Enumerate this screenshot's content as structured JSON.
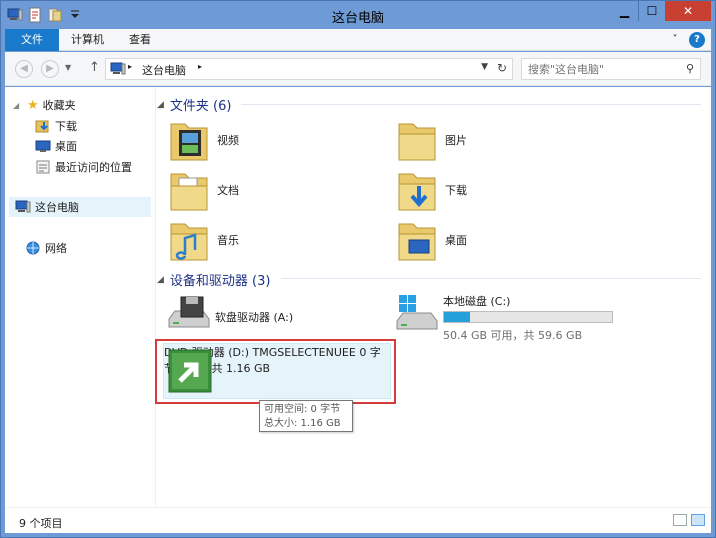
{
  "window": {
    "title": "这台电脑",
    "controls": {
      "minimize": "▁",
      "maximize": "☐",
      "close": "✕"
    }
  },
  "quick_access_icons": [
    "computer-icon",
    "properties-icon",
    "new-folder-icon",
    "customize-dropdown-icon"
  ],
  "ribbon": {
    "tabs": [
      "文件",
      "计算机",
      "查看"
    ],
    "expand_glyph": "˅",
    "help_glyph": "?"
  },
  "address_bar": {
    "breadcrumb": [
      "这台电脑"
    ],
    "separator": "▸",
    "search_placeholder": "搜索\"这台电脑\""
  },
  "navigation": {
    "favorites_label": "收藏夹",
    "favorites": [
      "下载",
      "桌面",
      "最近访问的位置"
    ],
    "this_pc": "这台电脑",
    "network": "网络"
  },
  "folders_section": {
    "heading": "文件夹 (6)",
    "items": [
      {
        "label": "视频",
        "icon": "videos-folder-icon"
      },
      {
        "label": "图片",
        "icon": "pictures-folder-icon"
      },
      {
        "label": "文档",
        "icon": "documents-folder-icon"
      },
      {
        "label": "下载",
        "icon": "downloads-folder-icon"
      },
      {
        "label": "音乐",
        "icon": "music-folder-icon"
      },
      {
        "label": "桌面",
        "icon": "desktop-folder-icon"
      }
    ]
  },
  "devices_section": {
    "heading": "设备和驱动器 (3)",
    "floppy": {
      "name": "软盘驱动器 (A:)"
    },
    "local_disk": {
      "name": "本地磁盘 (C:)",
      "space": "50.4 GB 可用，共 59.6 GB",
      "used_fraction": 0.154
    },
    "dvd": {
      "name": "DVD 驱动器 (D:)",
      "volume": "TMGSELECTENUEE",
      "space": "0 字节 可用，共 1.16 GB"
    }
  },
  "tooltip": {
    "line1": "可用空间: 0 字节",
    "line2": "总大小: 1.16 GB"
  },
  "status_bar": {
    "item_count": "9 个项目"
  },
  "colors": {
    "accent": "#1979ca",
    "highlight": "#e5f3fb",
    "annotation": "#d63b3b",
    "disk_bar": "#26a0da"
  }
}
